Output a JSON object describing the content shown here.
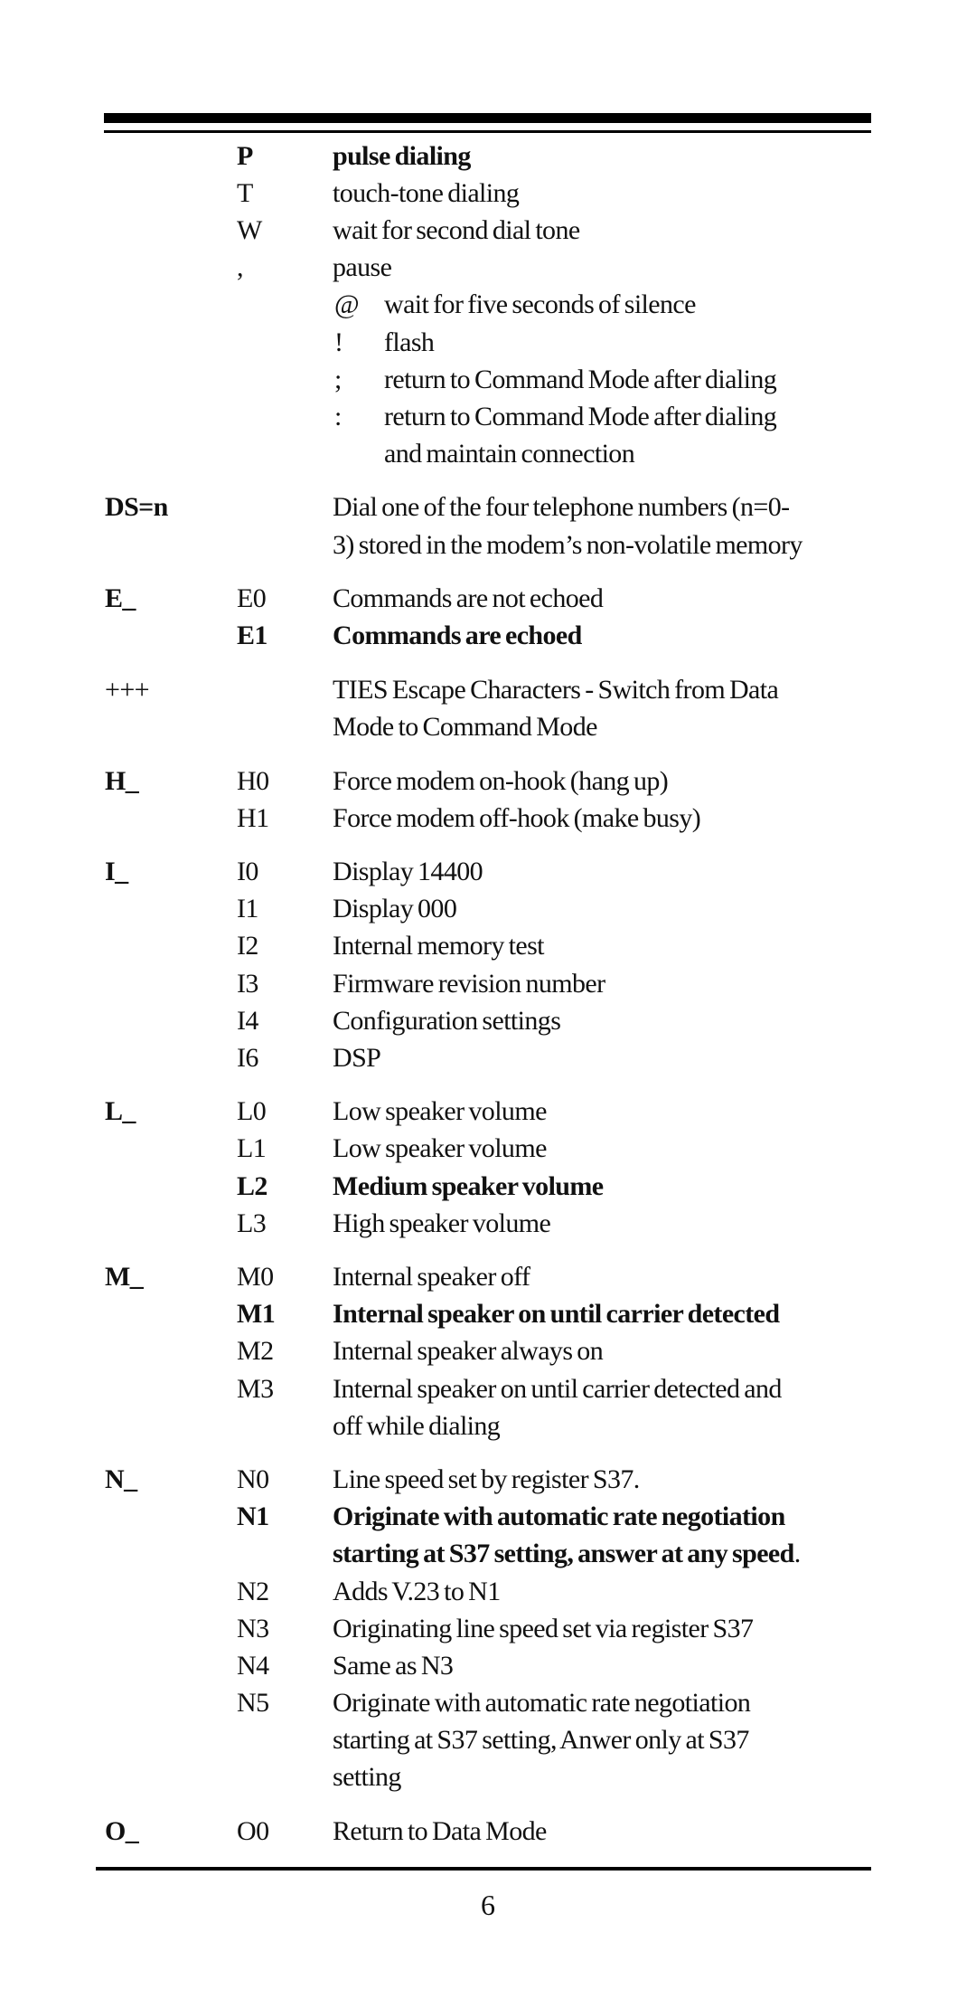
{
  "page": {
    "page_number": "6"
  },
  "groups": [
    {
      "command": "",
      "rows": [
        {
          "code": "P",
          "bold": true,
          "lines": [
            "pulse dialing"
          ]
        },
        {
          "code": "T",
          "bold": false,
          "lines": [
            "touch-tone dialing"
          ]
        },
        {
          "code": "W",
          "bold": false,
          "lines": [
            "wait for second dial tone"
          ]
        },
        {
          "code": ",",
          "bold": false,
          "lines": [
            "pause"
          ],
          "sub_items": [
            {
              "symbol": "@",
              "lines": [
                "wait for five seconds of silence"
              ]
            },
            {
              "symbol": "!",
              "lines": [
                "flash"
              ]
            },
            {
              "symbol": ";",
              "lines": [
                "return to Command Mode after dialing"
              ]
            },
            {
              "symbol": ":",
              "lines": [
                "return to Command Mode after dialing",
                "and maintain connection"
              ]
            }
          ]
        }
      ]
    },
    {
      "command": "DS=n",
      "rows": [
        {
          "code": "",
          "bold": false,
          "lines": [
            "Dial one of the four telephone numbers (n=0-",
            "3) stored in the modem’s non-volatile memory"
          ]
        }
      ]
    },
    {
      "command": "E_",
      "rows": [
        {
          "code": "E0",
          "bold": false,
          "lines": [
            "Commands are not echoed"
          ]
        },
        {
          "code": "E1",
          "bold": true,
          "lines": [
            "Commands are echoed"
          ]
        }
      ]
    },
    {
      "command": "+++",
      "command_bold": false,
      "rows": [
        {
          "code": "",
          "bold": false,
          "lines": [
            "TIES Escape Characters - Switch from Data",
            "Mode to Command Mode"
          ]
        }
      ]
    },
    {
      "command": "H_",
      "rows": [
        {
          "code": "H0",
          "bold": false,
          "lines": [
            "Force modem on-hook (hang up)"
          ]
        },
        {
          "code": "H1",
          "bold": false,
          "lines": [
            "Force modem off-hook (make busy)"
          ]
        }
      ]
    },
    {
      "command": "I_",
      "rows": [
        {
          "code": "I0",
          "bold": false,
          "lines": [
            "Display 14400"
          ]
        },
        {
          "code": "I1",
          "bold": false,
          "lines": [
            "Display 000"
          ]
        },
        {
          "code": "I2",
          "bold": false,
          "lines": [
            "Internal memory test"
          ]
        },
        {
          "code": "I3",
          "bold": false,
          "lines": [
            "Firmware revision number"
          ]
        },
        {
          "code": "I4",
          "bold": false,
          "lines": [
            "Configuration settings"
          ]
        },
        {
          "code": "I6",
          "bold": false,
          "lines": [
            "DSP"
          ]
        }
      ]
    },
    {
      "command": "L_",
      "rows": [
        {
          "code": "L0",
          "bold": false,
          "lines": [
            "Low speaker volume"
          ]
        },
        {
          "code": "L1",
          "bold": false,
          "lines": [
            "Low speaker volume"
          ]
        },
        {
          "code": "L2",
          "bold": true,
          "lines": [
            "Medium speaker volume"
          ]
        },
        {
          "code": "L3",
          "bold": false,
          "lines": [
            "High speaker volume"
          ]
        }
      ]
    },
    {
      "command": "M_",
      "rows": [
        {
          "code": "M0",
          "bold": false,
          "lines": [
            "Internal speaker off"
          ]
        },
        {
          "code": "M1",
          "bold": true,
          "lines": [
            "Internal speaker on until carrier detected"
          ]
        },
        {
          "code": "M2",
          "bold": false,
          "lines": [
            "Internal speaker always on"
          ]
        },
        {
          "code": "M3",
          "bold": false,
          "lines": [
            "Internal speaker on until carrier detected and",
            "off while dialing"
          ]
        }
      ]
    },
    {
      "command": "N_",
      "rows": [
        {
          "code": "N0",
          "bold": false,
          "lines": [
            "Line speed set by register S37."
          ]
        },
        {
          "code": "N1",
          "bold": true,
          "lines": [
            "Originate with automatic rate negotiation",
            "starting at S37 setting, answer at any speed"
          ],
          "trailing_normal": "."
        },
        {
          "code": "N2",
          "bold": false,
          "lines": [
            "Adds V.23 to N1"
          ]
        },
        {
          "code": "N3",
          "bold": false,
          "lines": [
            "Originating line speed set via register S37"
          ]
        },
        {
          "code": "N4",
          "bold": false,
          "lines": [
            "Same as N3"
          ]
        },
        {
          "code": "N5",
          "bold": false,
          "lines": [
            "Originate with automatic rate negotiation",
            "starting at S37 setting, Anwer only at S37",
            "setting"
          ]
        }
      ]
    },
    {
      "command": "O_",
      "rows": [
        {
          "code": "O0",
          "bold": false,
          "lines": [
            "Return to Data Mode"
          ]
        }
      ]
    }
  ]
}
